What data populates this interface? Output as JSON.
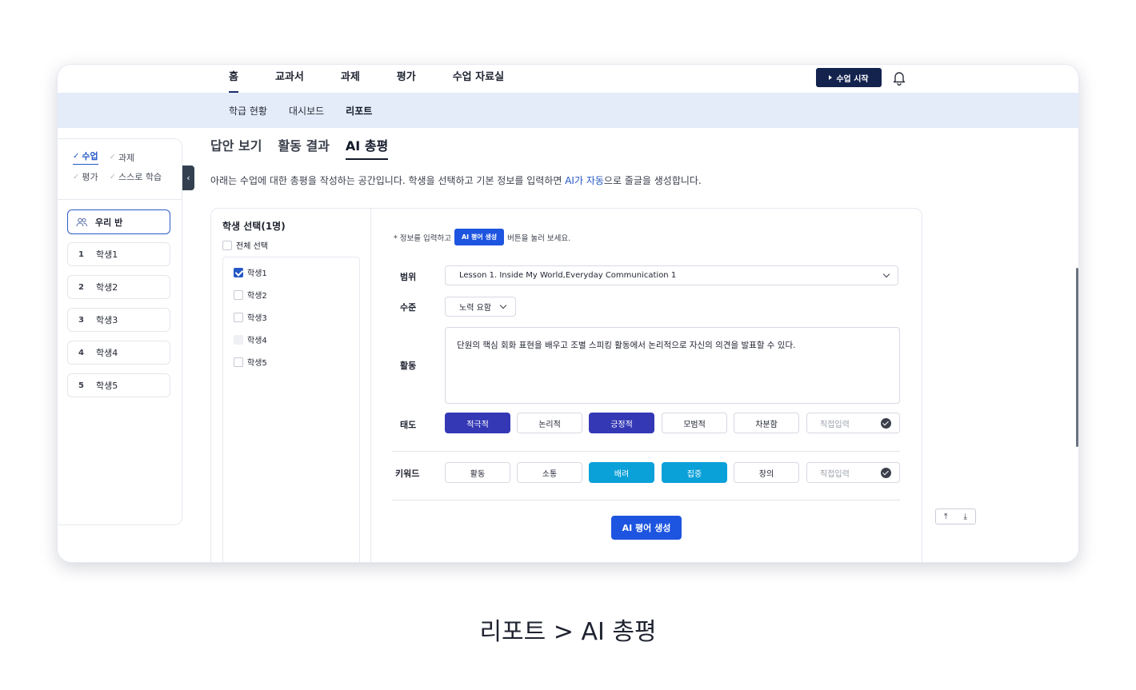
{
  "nav": {
    "menu": [
      "홈",
      "교과서",
      "과제",
      "평가",
      "수업 자료실"
    ],
    "start_label": "수업 시작"
  },
  "subnav": [
    "학급 현황",
    "대시보드",
    "리포트"
  ],
  "sidebar": {
    "tabs_row1": [
      "수업",
      "과제"
    ],
    "tabs_row2": [
      "평가",
      "스스로 학습"
    ],
    "class_label": "우리 반",
    "students": [
      {
        "num": "1",
        "name": "학생1"
      },
      {
        "num": "2",
        "name": "학생2"
      },
      {
        "num": "3",
        "name": "학생3"
      },
      {
        "num": "4",
        "name": "학생4"
      },
      {
        "num": "5",
        "name": "학생5"
      }
    ]
  },
  "content_tabs": [
    "답안 보기",
    "활동 결과",
    "AI 총평"
  ],
  "description": {
    "before": "아래는 수업에 대한 총평을 작성하는 공간입니다. 학생을 선택하고 기본 정보를 입력하면 ",
    "highlight": "AI가 자동",
    "after": "으로 줄글을 생성합니다."
  },
  "student_select": {
    "title": "학생 선택(1명)",
    "all_label": "전체 선택",
    "list": [
      "학생1",
      "학생2",
      "학생3",
      "학생4",
      "학생5"
    ]
  },
  "form": {
    "hint_before": "* 정보를 입력하고",
    "hint_pill": "AI 평어 생성",
    "hint_after": "버튼을 눌러 보세요.",
    "range_label": "범위",
    "range_value": "Lesson 1. Inside My World,Everyday Communication 1",
    "level_label": "수준",
    "level_value": "노력 요함",
    "activity_label": "활동",
    "activity_text": "단원의 핵심 회화 표현을 배우고 조별 스피킹 활동에서 논리적으로 자신의 의견을 발표할 수 있다.",
    "attitude_label": "태도",
    "attitude_chips": [
      "적극적",
      "논리적",
      "긍정적",
      "모범적",
      "차분함"
    ],
    "keyword_label": "키워드",
    "keyword_chips": [
      "활동",
      "소통",
      "배려",
      "집중",
      "창의"
    ],
    "custom_placeholder": "직접입력",
    "generate_label": "AI 평어 생성"
  },
  "scroll_controls": [
    "⤒",
    "⤓"
  ],
  "caption": "리포트 > AI 총평",
  "colors": {
    "navy": "#14224e",
    "chip_navy": "#3438b5",
    "chip_cyan": "#0aa0d8",
    "primary": "#1e55e0",
    "subnav_bg": "#e3ecf8"
  }
}
